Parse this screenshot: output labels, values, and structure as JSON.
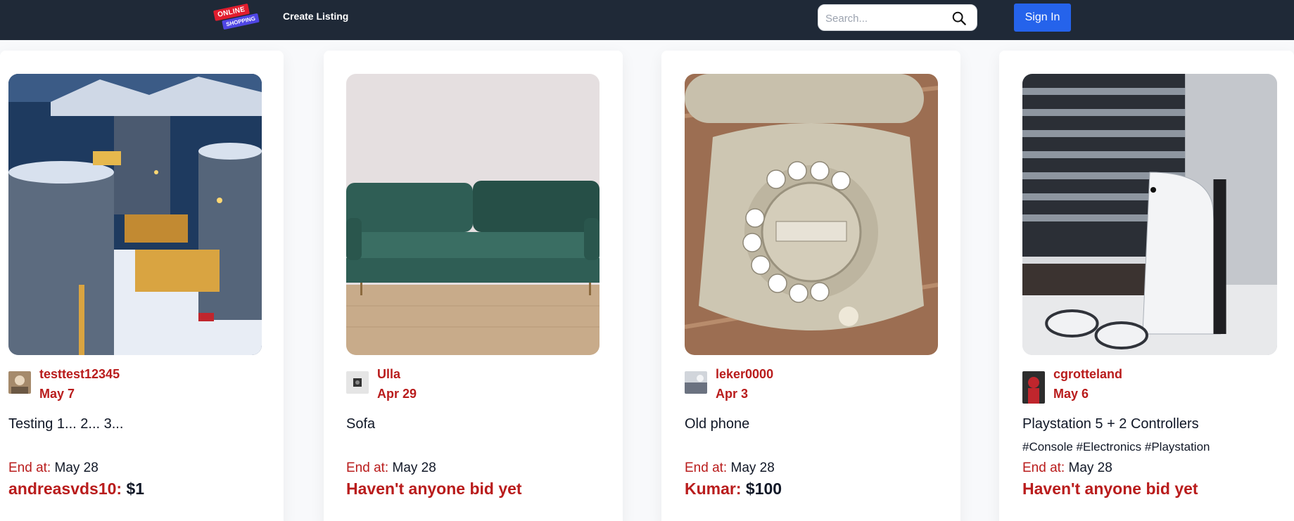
{
  "header": {
    "logo_line1": "ONLINE",
    "logo_line2": "SHOPPING",
    "create_listing": "Create Listing",
    "search_placeholder": "Search...",
    "search_icon": "search-icon",
    "signin_label": "Sign In"
  },
  "colors": {
    "navbar": "#1f2937",
    "accent_red": "#b91c1c",
    "signin_blue": "#2563eb"
  },
  "listings": [
    {
      "seller": "testtest12345",
      "date": "May 7",
      "title": "Testing 1... 2... 3...",
      "tags": "",
      "end_label": "End at:",
      "end_value": "May 28",
      "bid_label": "andreasvds10:",
      "bid_amount": "$1",
      "image": "industrial-plant-snow-image"
    },
    {
      "seller": "Ulla",
      "date": "Apr 29",
      "title": "Sofa",
      "tags": "",
      "end_label": "End at:",
      "end_value": "May 28",
      "bid_label": "Haven't anyone bid yet",
      "bid_amount": "",
      "image": "green-sofa-image"
    },
    {
      "seller": "leker0000",
      "date": "Apr 3",
      "title": "Old phone",
      "tags": "",
      "end_label": "End at:",
      "end_value": "May 28",
      "bid_label": "Kumar:",
      "bid_amount": "$100",
      "image": "rotary-phone-image"
    },
    {
      "seller": "cgrotteland",
      "date": "May 6",
      "title": "Playstation 5 + 2 Controllers",
      "tags": "#Console #Electronics #Playstation",
      "end_label": "End at:",
      "end_value": "May 28",
      "bid_label": "Haven't anyone bid yet",
      "bid_amount": "",
      "image": "playstation-image"
    }
  ]
}
